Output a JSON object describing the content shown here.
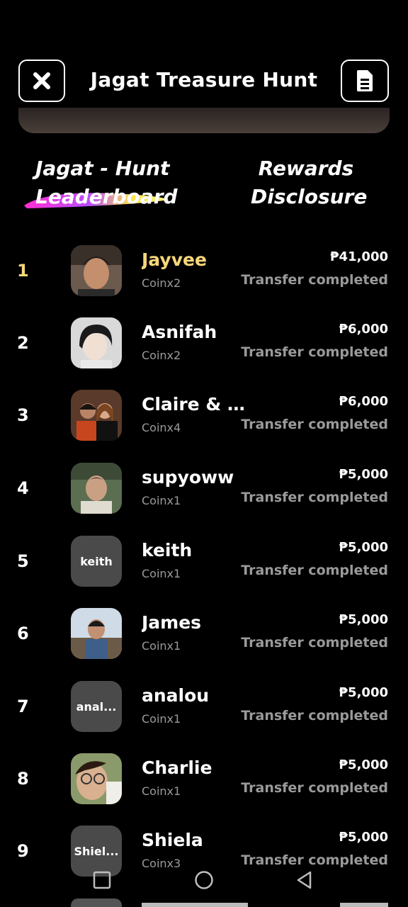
{
  "header": {
    "title": "Jagat Treasure Hunt",
    "close_icon": "close-icon",
    "document_icon": "document-icon"
  },
  "tabs": {
    "leaderboard_line1": "Jagat - Hunt",
    "leaderboard_line2": "Leaderboard",
    "rewards_line1": "Rewards",
    "rewards_line2": "Disclosure"
  },
  "leaderboard": [
    {
      "rank": "1",
      "name": "Jayvee",
      "sub": "Coinx2",
      "amount": "₱41,000",
      "status": "Transfer completed",
      "avatar_text": ""
    },
    {
      "rank": "2",
      "name": "Asnifah",
      "sub": "Coinx2",
      "amount": "₱6,000",
      "status": "Transfer completed",
      "avatar_text": ""
    },
    {
      "rank": "3",
      "name": "Claire & A...",
      "sub": "Coinx4",
      "amount": "₱6,000",
      "status": "Transfer completed",
      "avatar_text": ""
    },
    {
      "rank": "4",
      "name": "supyoww",
      "sub": "Coinx1",
      "amount": "₱5,000",
      "status": "Transfer completed",
      "avatar_text": ""
    },
    {
      "rank": "5",
      "name": "keith",
      "sub": "Coinx1",
      "amount": "₱5,000",
      "status": "Transfer completed",
      "avatar_text": "keith"
    },
    {
      "rank": "6",
      "name": "James",
      "sub": "Coinx1",
      "amount": "₱5,000",
      "status": "Transfer completed",
      "avatar_text": ""
    },
    {
      "rank": "7",
      "name": "analou",
      "sub": "Coinx1",
      "amount": "₱5,000",
      "status": "Transfer completed",
      "avatar_text": "anal..."
    },
    {
      "rank": "8",
      "name": "Charlie",
      "sub": "Coinx1",
      "amount": "₱5,000",
      "status": "Transfer completed",
      "avatar_text": ""
    },
    {
      "rank": "9",
      "name": "Shiela",
      "sub": "Coinx3",
      "amount": "₱5,000",
      "status": "Transfer completed",
      "avatar_text": "Shiel..."
    }
  ],
  "colors": {
    "background": "#000000",
    "rank1_gold": "#f6d77a",
    "muted_text": "#9a9a9a",
    "text_avatar_bg": "#4a4a4a"
  },
  "system_nav": {
    "recents_icon": "square-icon",
    "home_icon": "circle-icon",
    "back_icon": "triangle-back-icon"
  }
}
